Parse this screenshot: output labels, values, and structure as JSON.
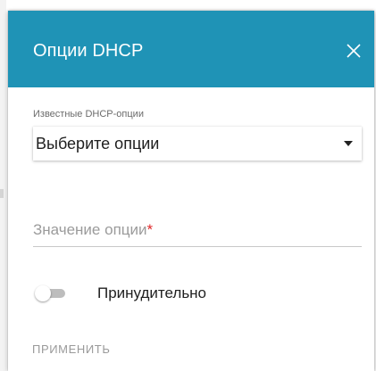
{
  "dialog": {
    "title": "Опции DHCP",
    "close_icon": "close-icon"
  },
  "known_options": {
    "label": "Известные DHCP-опции",
    "selected": "Выберите опции",
    "caret_icon": "caret-down-icon"
  },
  "option_value": {
    "placeholder": "Значение опции",
    "required_mark": "*",
    "value": ""
  },
  "force_toggle": {
    "label": "Принудительно",
    "state": false
  },
  "actions": {
    "apply_label": "ПРИМЕНИТЬ"
  },
  "colors": {
    "header": "#1f93b6",
    "required": "#e0282a",
    "toggle_off": "#bdbdbd"
  }
}
